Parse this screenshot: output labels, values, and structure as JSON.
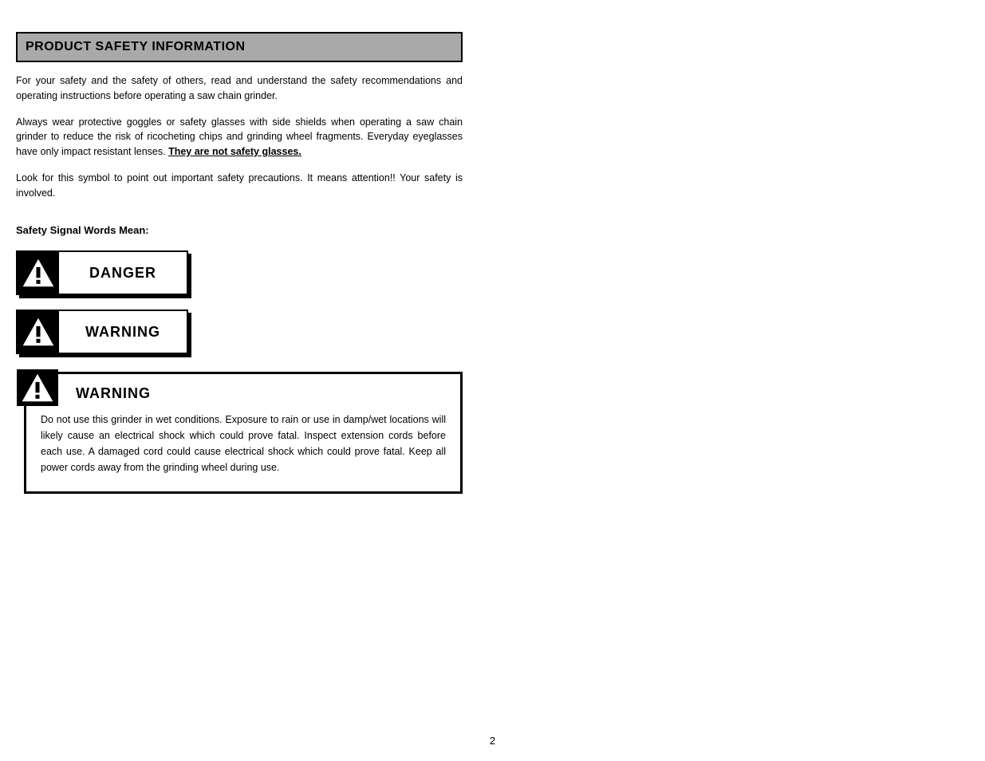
{
  "header": "PRODUCT SAFETY INFORMATION",
  "para1": "For your safety and the safety of others, read and understand the safety recommendations and operating instructions before operating a saw chain grinder.",
  "para2_prefix": "Always wear protective goggles or safety glasses with side shields when operating a saw chain grinder to reduce the risk of ricocheting chips and grinding wheel fragments. Everyday eyeglasses have only impact resistant lenses. ",
  "para2_underline": "They are not safety glasses.",
  "para3": "Look for this symbol to point out important safety precautions. It means attention!! Your safety is involved.",
  "def_line": "Safety Signal Words Mean:",
  "danger_label": "DANGER",
  "warning_label": "WARNING",
  "warning_title": "WARNING",
  "warning_body": "Do not use this grinder in wet conditions. Exposure to rain or use in damp/wet locations will likely cause an electrical shock which could prove fatal. Inspect extension cords before each use. A damaged cord could cause electrical shock which could prove fatal. Keep all power cords away from the grinding wheel during use.",
  "page_number": "2"
}
